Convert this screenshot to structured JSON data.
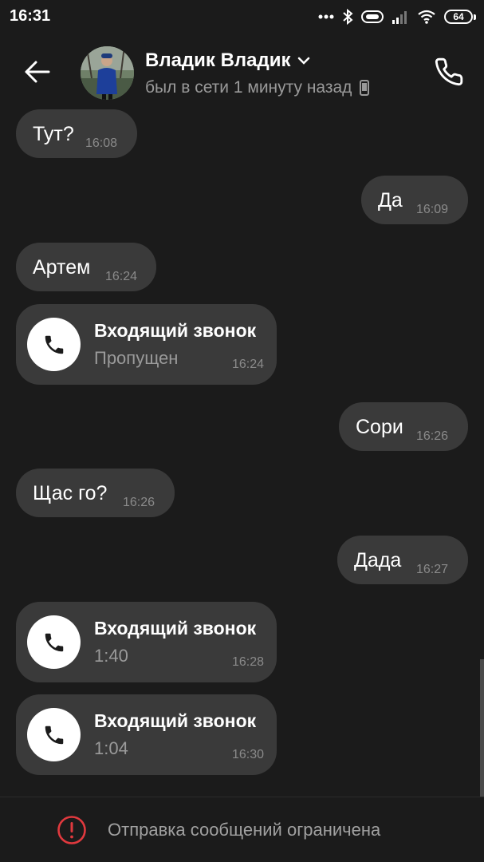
{
  "status_bar": {
    "time": "16:31",
    "battery": "64",
    "icons": [
      "more-dots-icon",
      "bluetooth-icon",
      "vibrate-icon",
      "signal-icon",
      "wifi-icon",
      "battery-icon"
    ]
  },
  "header": {
    "contact_name": "Владик Владик",
    "last_seen": "был в сети 1 минуту назад",
    "icons": [
      "back-arrow-icon",
      "chevron-down-icon",
      "phone-device-icon",
      "phone-call-icon"
    ]
  },
  "messages": [
    {
      "dir": "in",
      "type": "text",
      "text": "Тут?",
      "time": "16:08"
    },
    {
      "dir": "out",
      "type": "text",
      "text": "Да",
      "time": "16:09"
    },
    {
      "dir": "in",
      "type": "text",
      "text": "Артем",
      "time": "16:24"
    },
    {
      "dir": "in",
      "type": "call",
      "title": "Входящий звонок",
      "sub": "Пропущен",
      "time": "16:24"
    },
    {
      "dir": "out",
      "type": "text",
      "text": "Сори",
      "time": "16:26"
    },
    {
      "dir": "in",
      "type": "text",
      "text": "Щас го?",
      "time": "16:26"
    },
    {
      "dir": "out",
      "type": "text",
      "text": "Дада",
      "time": "16:27"
    },
    {
      "dir": "in",
      "type": "call",
      "title": "Входящий звонок",
      "sub": "1:40",
      "time": "16:28"
    },
    {
      "dir": "in",
      "type": "call",
      "title": "Входящий звонок",
      "sub": "1:04",
      "time": "16:30"
    }
  ],
  "bottom": {
    "restricted_text": "Отправка сообщений ограничена",
    "icon": "alert-circle-icon",
    "icon_color": "#e0393e"
  },
  "colors": {
    "background": "#1b1b1b",
    "bubble": "#3a3a3a",
    "secondary_text": "#9a9a9a"
  }
}
